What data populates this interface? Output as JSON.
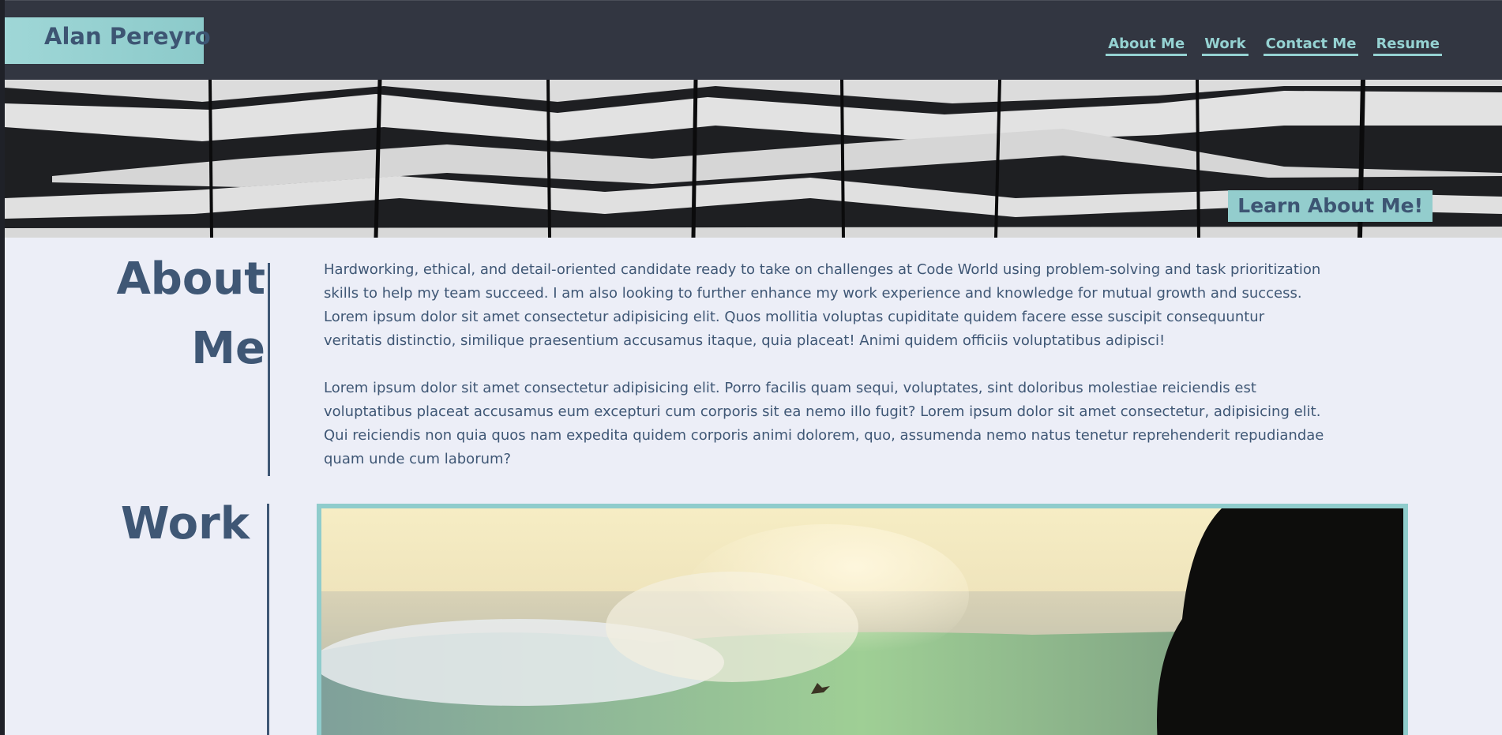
{
  "header": {
    "brand": "Alan Pereyro",
    "nav": [
      {
        "label": "About Me"
      },
      {
        "label": "Work"
      },
      {
        "label": "Contact Me"
      },
      {
        "label": "Resume"
      }
    ]
  },
  "hero": {
    "button_label": "Learn About Me!"
  },
  "about": {
    "title_line1": "About",
    "title_line2": "Me",
    "paragraphs": [
      "Hardworking, ethical, and detail-oriented candidate ready to take on challenges at Code World using problem-solving and task prioritization skills to help my team succeed. I am also looking to further enhance my work experience and knowledge for mutual growth and success. Lorem ipsum dolor sit amet consectetur adipisicing elit. Quos mollitia voluptas cupiditate quidem facere esse suscipit consequuntur veritatis distinctio, similique praesentium accusamus itaque, quia placeat! Animi quidem officiis voluptatibus adipisci!",
      "Lorem ipsum dolor sit amet consectetur adipisicing elit. Porro facilis quam sequi, voluptates, sint doloribus molestiae reiciendis est voluptatibus placeat accusamus eum excepturi cum corporis sit ea nemo illo fugit? Lorem ipsum dolor sit amet consectetur, adipisicing elit. Qui reiciendis non quia quos nam expedita quidem corporis animi dolorem, quo, assumenda nemo natus tenetur reprehenderit repudiandae quam unde cum laborum?"
    ]
  },
  "work": {
    "title": "Work"
  },
  "colors": {
    "header_bg": "#323641",
    "accent": "#95d2d2",
    "heading": "#3f5775",
    "page_bg": "#eceef7"
  }
}
